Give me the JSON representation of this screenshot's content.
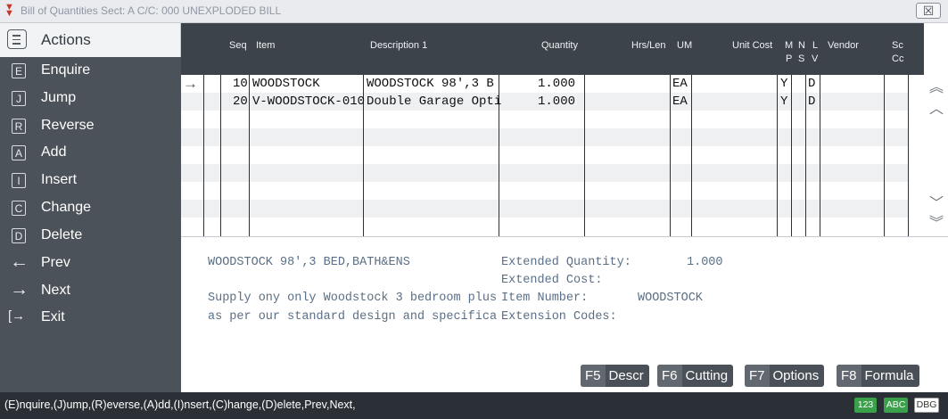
{
  "window": {
    "title": "Bill of Quantities  Sect: A  C/C: 000 UNEXPLODED BILL"
  },
  "sidebar": {
    "header": "Actions",
    "items": [
      {
        "key": "E",
        "label": "Enquire"
      },
      {
        "key": "J",
        "label": "Jump"
      },
      {
        "key": "R",
        "label": "Reverse"
      },
      {
        "key": "A",
        "label": "Add"
      },
      {
        "key": "I",
        "label": "Insert"
      },
      {
        "key": "C",
        "label": "Change"
      },
      {
        "key": "D",
        "label": "Delete"
      },
      {
        "key": "←",
        "label": "Prev"
      },
      {
        "key": "→",
        "label": "Next"
      },
      {
        "key": "[→",
        "label": "Exit"
      }
    ]
  },
  "grid": {
    "columns": {
      "seq": "Seq",
      "item": "Item",
      "description": "Description 1",
      "quantity": "Quantity",
      "hrs_len": "Hrs/Len",
      "um": "UM",
      "unit_cost": "Unit Cost",
      "mp_top": "M",
      "mp_bottom": "P",
      "ns_top": "N",
      "ns_bottom": "S",
      "lv_top": "L",
      "lv_bottom": "V",
      "vendor": "Vendor",
      "sccc_top": "Sc",
      "sccc_bottom": "Cc"
    },
    "pointer": "→",
    "rows": [
      {
        "seq": "10",
        "item": "WOODSTOCK",
        "description": "WOODSTOCK  98',3 B",
        "quantity": "1.000",
        "um": "EA",
        "mp": "Y",
        "lv": "D"
      },
      {
        "seq": "20",
        "item": "V-WOODSTOCK-010",
        "description": "Double Garage Opti",
        "quantity": "1.000",
        "um": "EA",
        "mp": "Y",
        "lv": "D"
      }
    ]
  },
  "detail": {
    "line1": "WOODSTOCK  98',3 BED,BATH&ENS",
    "line3": "Supply ony only Woodstock 3 bedroom plus",
    "line4": "as per our standard design and specifica",
    "ext_qty_label": "Extended Quantity:",
    "ext_qty_value": "1.000",
    "ext_cost_label": "Extended Cost:",
    "item_number_label": "Item Number:",
    "item_number_value": "WOODSTOCK",
    "ext_codes_label": "Extension Codes:"
  },
  "function_keys": [
    {
      "key": "F5",
      "label": "Descr"
    },
    {
      "key": "F6",
      "label": "Cutting"
    },
    {
      "key": "F7",
      "label": "Options"
    },
    {
      "key": "F8",
      "label": "Formula"
    }
  ],
  "statusbar": {
    "text": "(E)nquire,(J)ump,(R)everse,(A)dd,(I)nsert,(C)hange,(D)elete,Prev,Next,",
    "badge_num": "123",
    "badge_abc": "ABC",
    "badge_dbg": "DBG"
  },
  "colors": {
    "sidebar_bg": "#4c5259",
    "header_bg": "#3c434b",
    "detail_text": "#5a6f86",
    "badge_green": "#3aa04a"
  }
}
